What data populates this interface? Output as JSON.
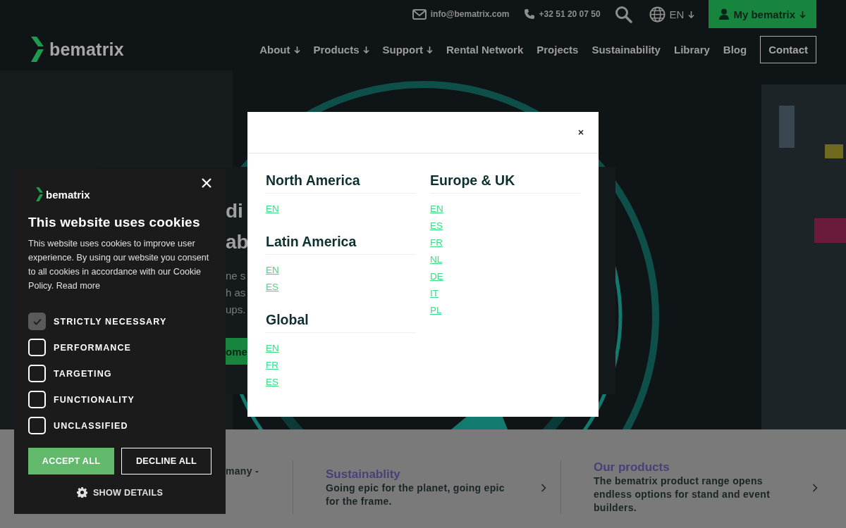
{
  "top_bar": {
    "email": "info@bematrix.com",
    "phone": "+32 51 20 07 50",
    "language": "EN",
    "account_button": "My bematrix"
  },
  "logo": "bematrix",
  "nav": [
    {
      "label": "About",
      "kind": "dropdown"
    },
    {
      "label": "Products",
      "kind": "dropdown"
    },
    {
      "label": "Support",
      "kind": "dropdown"
    },
    {
      "label": "Rental Network",
      "kind": "link"
    },
    {
      "label": "Projects",
      "kind": "link"
    },
    {
      "label": "Sustainability",
      "kind": "link"
    },
    {
      "label": "Library",
      "kind": "link"
    },
    {
      "label": "Blog",
      "kind": "link"
    },
    {
      "label": "Contact",
      "kind": "outlined"
    }
  ],
  "hero": {
    "heading_lines": [
      "di",
      "ab"
    ],
    "text_lines": [
      "ne s",
      "h as",
      "ups."
    ],
    "button": "ome"
  },
  "features": [
    {
      "text": "many -"
    },
    {
      "title": "Sustainablity",
      "text": "Going epic for the planet, going epic for the frame."
    },
    {
      "title": "Our products",
      "text": "The bematrix product range opens endless options for stand and event builders."
    }
  ],
  "cookie_banner": {
    "logo": "bematrix",
    "title": "This website uses cookies",
    "body": "This website uses cookies to improve user experience. By using our website you consent to all cookies in accordance with our Cookie Policy.",
    "link": "Read more",
    "categories": [
      {
        "label": "STRICTLY NECESSARY",
        "checked": true,
        "disabled": true
      },
      {
        "label": "PERFORMANCE",
        "checked": false,
        "disabled": false
      },
      {
        "label": "TARGETING",
        "checked": false,
        "disabled": false
      },
      {
        "label": "FUNCTIONALITY",
        "checked": false,
        "disabled": false
      },
      {
        "label": "UNCLASSIFIED",
        "checked": false,
        "disabled": false
      }
    ],
    "accept_button": "ACCEPT ALL",
    "decline_button": "DECLINE ALL",
    "details_button": "SHOW DETAILS"
  },
  "region_modal": {
    "columns": [
      [
        {
          "name": "North America",
          "languages": [
            "EN"
          ]
        },
        {
          "name": "Latin America",
          "languages": [
            "EN",
            "ES"
          ]
        },
        {
          "name": "Global",
          "languages": [
            "EN",
            "FR",
            "ES"
          ]
        }
      ],
      [
        {
          "name": "Europe & UK",
          "languages": [
            "EN",
            "ES",
            "FR",
            "NL",
            "DE",
            "IT",
            "PL"
          ]
        }
      ]
    ]
  }
}
